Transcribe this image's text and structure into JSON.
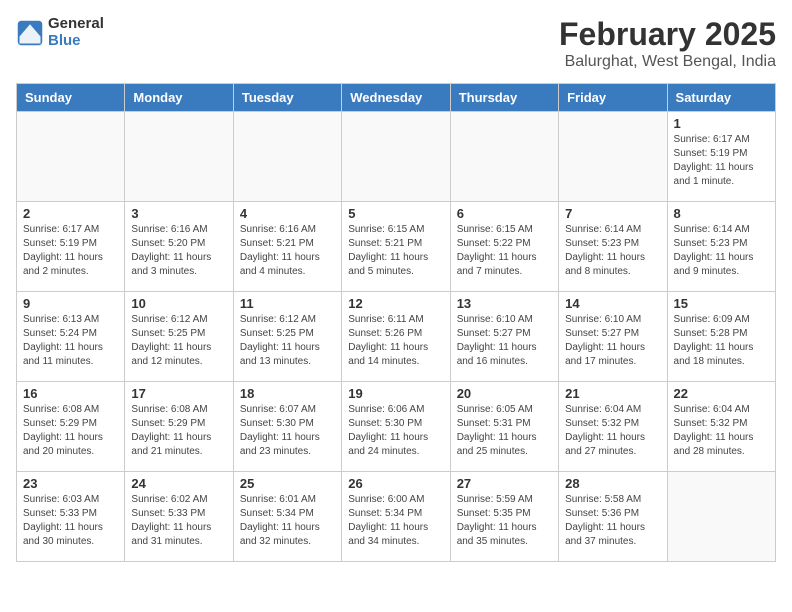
{
  "header": {
    "logo_line1": "General",
    "logo_line2": "Blue",
    "main_title": "February 2025",
    "subtitle": "Balurghat, West Bengal, India"
  },
  "days_of_week": [
    "Sunday",
    "Monday",
    "Tuesday",
    "Wednesday",
    "Thursday",
    "Friday",
    "Saturday"
  ],
  "weeks": [
    [
      {
        "day": "",
        "info": ""
      },
      {
        "day": "",
        "info": ""
      },
      {
        "day": "",
        "info": ""
      },
      {
        "day": "",
        "info": ""
      },
      {
        "day": "",
        "info": ""
      },
      {
        "day": "",
        "info": ""
      },
      {
        "day": "1",
        "info": "Sunrise: 6:17 AM\nSunset: 5:19 PM\nDaylight: 11 hours\nand 1 minute."
      }
    ],
    [
      {
        "day": "2",
        "info": "Sunrise: 6:17 AM\nSunset: 5:19 PM\nDaylight: 11 hours\nand 2 minutes."
      },
      {
        "day": "3",
        "info": "Sunrise: 6:16 AM\nSunset: 5:20 PM\nDaylight: 11 hours\nand 3 minutes."
      },
      {
        "day": "4",
        "info": "Sunrise: 6:16 AM\nSunset: 5:21 PM\nDaylight: 11 hours\nand 4 minutes."
      },
      {
        "day": "5",
        "info": "Sunrise: 6:15 AM\nSunset: 5:21 PM\nDaylight: 11 hours\nand 5 minutes."
      },
      {
        "day": "6",
        "info": "Sunrise: 6:15 AM\nSunset: 5:22 PM\nDaylight: 11 hours\nand 7 minutes."
      },
      {
        "day": "7",
        "info": "Sunrise: 6:14 AM\nSunset: 5:23 PM\nDaylight: 11 hours\nand 8 minutes."
      },
      {
        "day": "8",
        "info": "Sunrise: 6:14 AM\nSunset: 5:23 PM\nDaylight: 11 hours\nand 9 minutes."
      }
    ],
    [
      {
        "day": "9",
        "info": "Sunrise: 6:13 AM\nSunset: 5:24 PM\nDaylight: 11 hours\nand 11 minutes."
      },
      {
        "day": "10",
        "info": "Sunrise: 6:12 AM\nSunset: 5:25 PM\nDaylight: 11 hours\nand 12 minutes."
      },
      {
        "day": "11",
        "info": "Sunrise: 6:12 AM\nSunset: 5:25 PM\nDaylight: 11 hours\nand 13 minutes."
      },
      {
        "day": "12",
        "info": "Sunrise: 6:11 AM\nSunset: 5:26 PM\nDaylight: 11 hours\nand 14 minutes."
      },
      {
        "day": "13",
        "info": "Sunrise: 6:10 AM\nSunset: 5:27 PM\nDaylight: 11 hours\nand 16 minutes."
      },
      {
        "day": "14",
        "info": "Sunrise: 6:10 AM\nSunset: 5:27 PM\nDaylight: 11 hours\nand 17 minutes."
      },
      {
        "day": "15",
        "info": "Sunrise: 6:09 AM\nSunset: 5:28 PM\nDaylight: 11 hours\nand 18 minutes."
      }
    ],
    [
      {
        "day": "16",
        "info": "Sunrise: 6:08 AM\nSunset: 5:29 PM\nDaylight: 11 hours\nand 20 minutes."
      },
      {
        "day": "17",
        "info": "Sunrise: 6:08 AM\nSunset: 5:29 PM\nDaylight: 11 hours\nand 21 minutes."
      },
      {
        "day": "18",
        "info": "Sunrise: 6:07 AM\nSunset: 5:30 PM\nDaylight: 11 hours\nand 23 minutes."
      },
      {
        "day": "19",
        "info": "Sunrise: 6:06 AM\nSunset: 5:30 PM\nDaylight: 11 hours\nand 24 minutes."
      },
      {
        "day": "20",
        "info": "Sunrise: 6:05 AM\nSunset: 5:31 PM\nDaylight: 11 hours\nand 25 minutes."
      },
      {
        "day": "21",
        "info": "Sunrise: 6:04 AM\nSunset: 5:32 PM\nDaylight: 11 hours\nand 27 minutes."
      },
      {
        "day": "22",
        "info": "Sunrise: 6:04 AM\nSunset: 5:32 PM\nDaylight: 11 hours\nand 28 minutes."
      }
    ],
    [
      {
        "day": "23",
        "info": "Sunrise: 6:03 AM\nSunset: 5:33 PM\nDaylight: 11 hours\nand 30 minutes."
      },
      {
        "day": "24",
        "info": "Sunrise: 6:02 AM\nSunset: 5:33 PM\nDaylight: 11 hours\nand 31 minutes."
      },
      {
        "day": "25",
        "info": "Sunrise: 6:01 AM\nSunset: 5:34 PM\nDaylight: 11 hours\nand 32 minutes."
      },
      {
        "day": "26",
        "info": "Sunrise: 6:00 AM\nSunset: 5:34 PM\nDaylight: 11 hours\nand 34 minutes."
      },
      {
        "day": "27",
        "info": "Sunrise: 5:59 AM\nSunset: 5:35 PM\nDaylight: 11 hours\nand 35 minutes."
      },
      {
        "day": "28",
        "info": "Sunrise: 5:58 AM\nSunset: 5:36 PM\nDaylight: 11 hours\nand 37 minutes."
      },
      {
        "day": "",
        "info": ""
      }
    ]
  ]
}
